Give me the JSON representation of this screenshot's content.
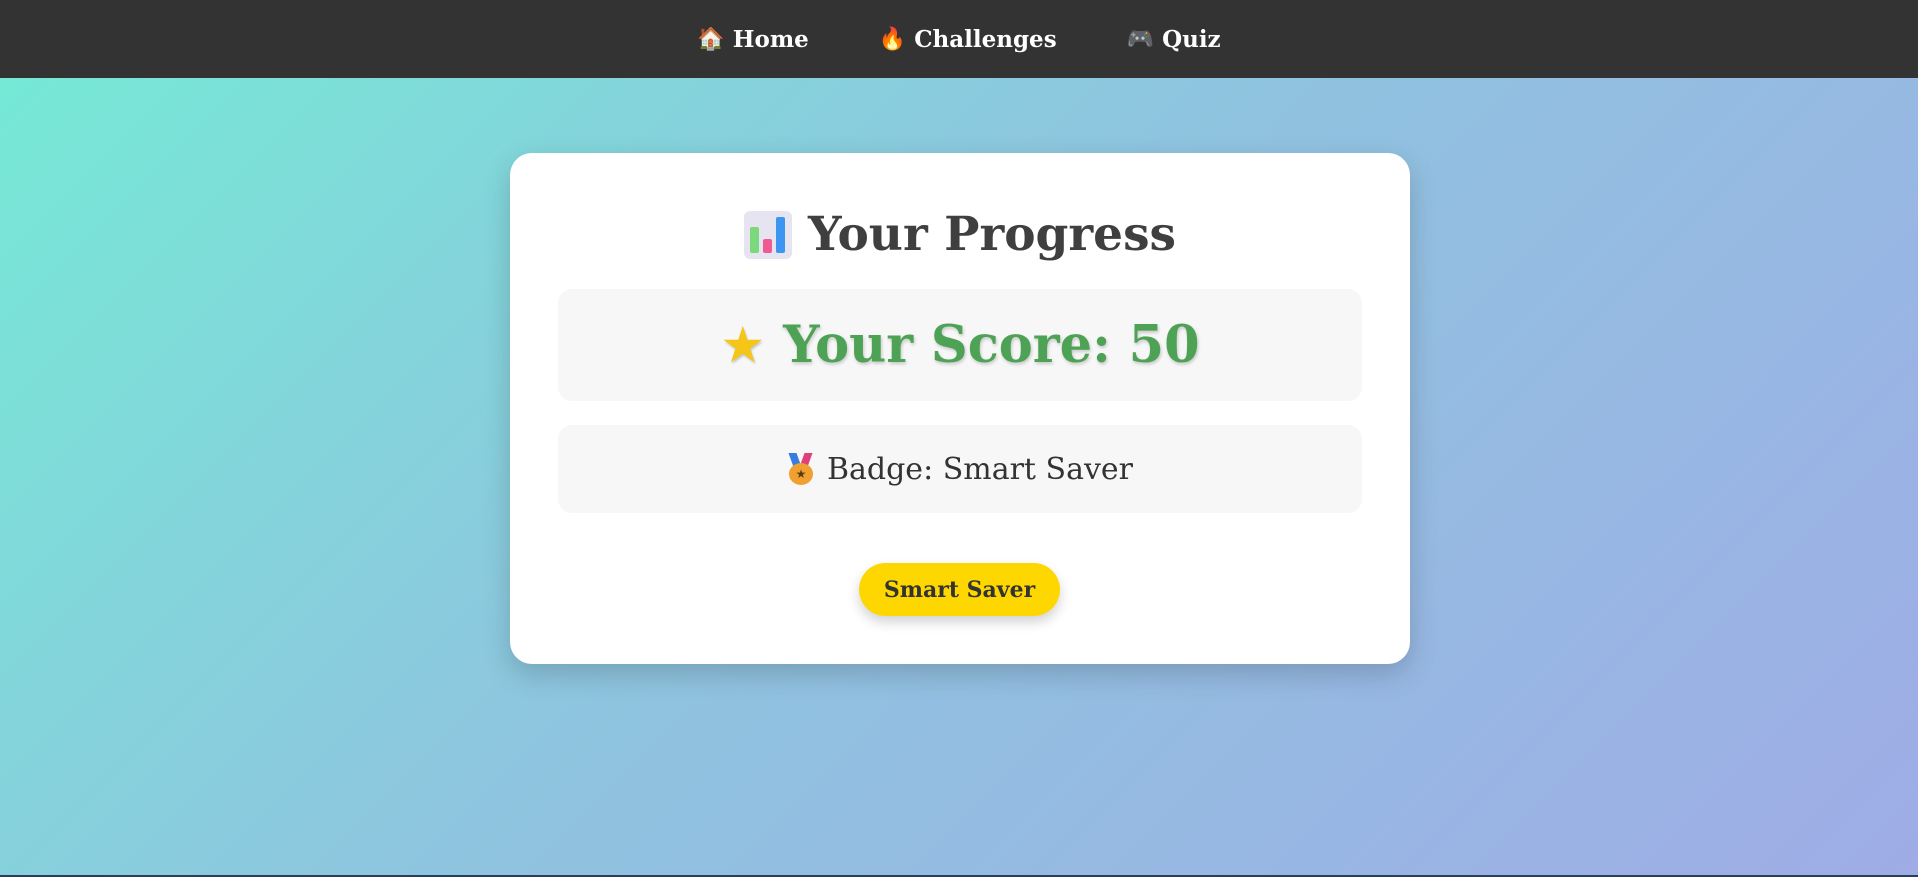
{
  "nav": {
    "items": [
      {
        "icon": "house-icon",
        "glyph": "🏠",
        "label": "Home"
      },
      {
        "icon": "fire-icon",
        "glyph": "🔥",
        "label": "Challenges"
      },
      {
        "icon": "game-controller-icon",
        "glyph": "🎮",
        "label": "Quiz"
      }
    ]
  },
  "progress": {
    "title": "Your Progress",
    "title_icon": "bar-chart-icon",
    "score_label": "Your Score: 50",
    "score_icon": "star-icon",
    "badge_label": "Badge: Smart Saver",
    "badge_icon": "medal-icon",
    "badge_button": "Smart Saver"
  },
  "colors": {
    "nav_bg": "#333333",
    "score_text": "#4ea255",
    "badge_button_bg": "#ffd700",
    "gradient_start": "#74ebd5",
    "gradient_end": "#9face6"
  }
}
